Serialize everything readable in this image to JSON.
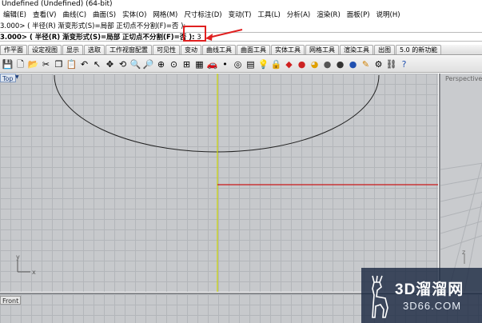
{
  "window": {
    "title": "Undefined (Undefined) (64-bit)"
  },
  "menu": [
    "编辑(E)",
    "查看(V)",
    "曲线(C)",
    "曲面(S)",
    "实体(O)",
    "网格(M)",
    "尺寸标注(D)",
    "变动(T)",
    "工具(L)",
    "分析(A)",
    "渲染(R)",
    "面板(P)",
    "说明(H)"
  ],
  "command": {
    "history": "3.000> ( 半径(R)  渐变形式(S)=局部  正切点不分割(F)=否 ):",
    "prompt": "3.000> ( 半径(R)  渐变形式(S)=局部  正切点不分割(F)=否 ):",
    "input_value": "3"
  },
  "tabs": [
    "作平面",
    "设定视图",
    "显示",
    "选取",
    "工作视窗配置",
    "可见性",
    "变动",
    "曲线工具",
    "曲面工具",
    "实体工具",
    "网格工具",
    "渲染工具",
    "出图",
    "5.0 的新功能"
  ],
  "toolbar_icons": [
    "save-icon",
    "new-file-icon",
    "open-icon",
    "cut-icon",
    "copy-icon",
    "paste-icon",
    "undo-icon",
    "select-icon",
    "pan-icon",
    "rotate-view-icon",
    "zoom-icon",
    "zoom-window-icon",
    "zoom-extents-icon",
    "zoom-selected-icon",
    "four-view-icon",
    "grid-icon",
    "car-icon",
    "point-icon",
    "snap-icon",
    "properties-icon",
    "light-icon",
    "lock-icon",
    "layer-icon",
    "material-icon",
    "color-wheel-icon",
    "sphere-icon",
    "render-icon",
    "render-preview-icon",
    "pen-icon",
    "gear-icon",
    "link-icon",
    "help-icon"
  ],
  "viewports": {
    "top_label": "Top",
    "perspective_label": "Perspective",
    "front_label": "Front",
    "axis_y": "y",
    "axis_x": "x",
    "axis_z": "z"
  },
  "watermark": {
    "brand": "3D溜溜网",
    "url": "3D66.COM"
  },
  "colors": {
    "highlight": "#e02020",
    "y_axis": "#c8d400",
    "x_axis": "#c81818",
    "curve": "#222222"
  }
}
